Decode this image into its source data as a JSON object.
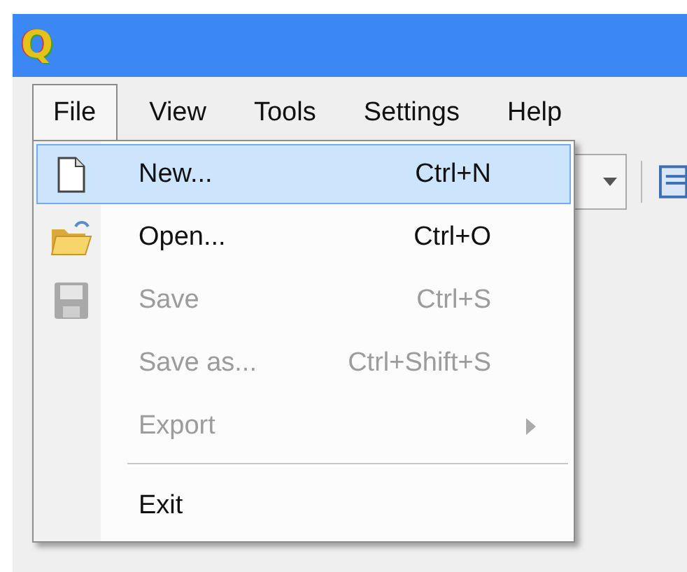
{
  "title_bar": {
    "logo": "Q"
  },
  "menu_bar": [
    {
      "label": "File",
      "selected": true
    },
    {
      "label": "View",
      "selected": false
    },
    {
      "label": "Tools",
      "selected": false
    },
    {
      "label": "Settings",
      "selected": false
    },
    {
      "label": "Help",
      "selected": false
    }
  ],
  "file_menu": [
    {
      "kind": "item",
      "label": "New...",
      "shortcut": "Ctrl+N",
      "selected": true,
      "disabled": false
    },
    {
      "kind": "item",
      "label": "Open...",
      "shortcut": "Ctrl+O",
      "selected": false,
      "disabled": false
    },
    {
      "kind": "item",
      "label": "Save",
      "shortcut": "Ctrl+S",
      "selected": false,
      "disabled": true
    },
    {
      "kind": "item",
      "label": "Save as...",
      "shortcut": "Ctrl+Shift+S",
      "selected": false,
      "disabled": true
    },
    {
      "kind": "submenu",
      "label": "Export",
      "selected": false,
      "disabled": true
    },
    {
      "kind": "separator"
    },
    {
      "kind": "item",
      "label": "Exit",
      "selected": false,
      "disabled": false
    }
  ]
}
